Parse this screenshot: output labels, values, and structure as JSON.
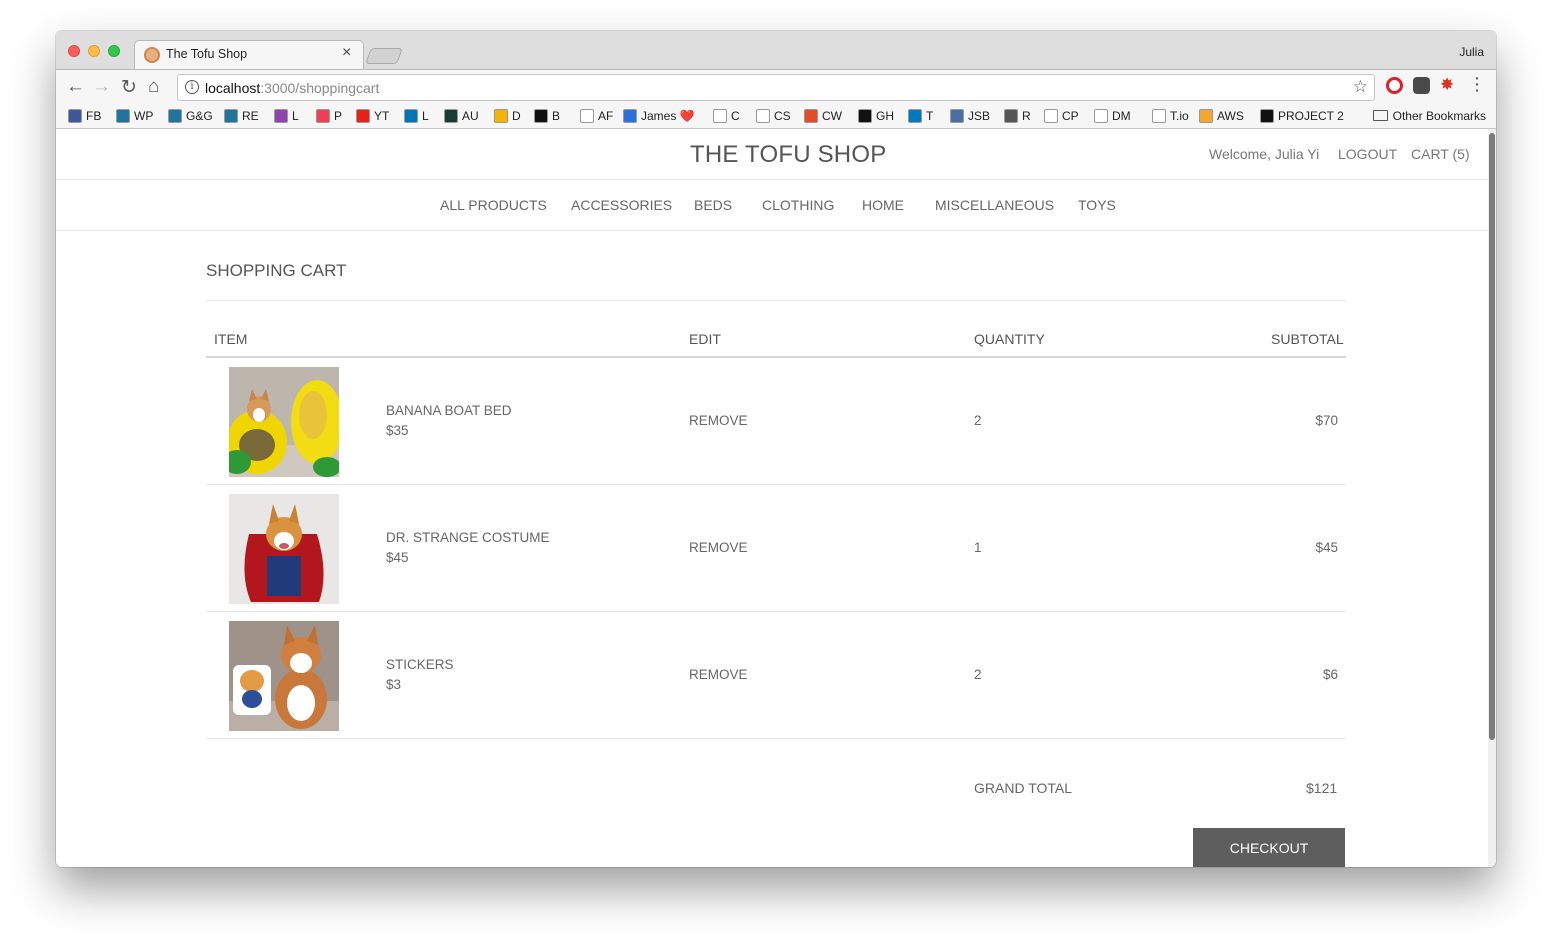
{
  "browser": {
    "tab_title": "The Tofu Shop",
    "tab_close": "×",
    "profile_name": "Julia",
    "url_host": "localhost",
    "url_path": ":3000/shoppingcart",
    "bookmarks": [
      {
        "label": "FB",
        "color": "#3b5998"
      },
      {
        "label": "WP",
        "color": "#21759b"
      },
      {
        "label": "G&G",
        "color": "#21759b"
      },
      {
        "label": "RE",
        "color": "#21759b"
      },
      {
        "label": "L",
        "color": "#8e44ad"
      },
      {
        "label": "P",
        "color": "#ef4056"
      },
      {
        "label": "YT",
        "color": "#e62117"
      },
      {
        "label": "L",
        "color": "#0077b5"
      },
      {
        "label": "AU",
        "color": "#1a3c34"
      },
      {
        "label": "D",
        "color": "#f4b400"
      },
      {
        "label": "B",
        "color": "#111111"
      },
      {
        "label": "AF",
        "color": "#ffffff"
      },
      {
        "label": "James ❤️",
        "color": "#2a6fdb"
      },
      {
        "label": "C",
        "color": "#ffffff"
      },
      {
        "label": "CS",
        "color": "#ffffff"
      },
      {
        "label": "CW",
        "color": "#e34c26"
      },
      {
        "label": "GH",
        "color": "#111111"
      },
      {
        "label": "T",
        "color": "#0079bf"
      },
      {
        "label": "JSB",
        "color": "#4a6fa5"
      },
      {
        "label": "R",
        "color": "#555555"
      },
      {
        "label": "CP",
        "color": "#ffffff"
      },
      {
        "label": "DM",
        "color": "#ffffff"
      },
      {
        "label": "T.io",
        "color": "#ffffff"
      },
      {
        "label": "AWS",
        "color": "#f0a830"
      },
      {
        "label": "PROJECT 2",
        "color": "#111111"
      }
    ],
    "other_bookmarks": "Other Bookmarks"
  },
  "site": {
    "brand": "THE TOFU SHOP",
    "welcome": "Welcome, Julia Yi",
    "logout": "LOGOUT",
    "cart": "CART (5)",
    "categories": [
      "ALL PRODUCTS",
      "ACCESSORIES",
      "BEDS",
      "CLOTHING",
      "HOME",
      "MISCELLANEOUS",
      "TOYS"
    ]
  },
  "cart": {
    "title": "SHOPPING CART",
    "headers": {
      "item": "ITEM",
      "edit": "EDIT",
      "quantity": "QUANTITY",
      "subtotal": "SUBTOTAL"
    },
    "items": [
      {
        "name": "BANANA BOAT BED",
        "price": "$35",
        "action": "REMOVE",
        "quantity": "2",
        "subtotal": "$70"
      },
      {
        "name": "DR. STRANGE COSTUME",
        "price": "$45",
        "action": "REMOVE",
        "quantity": "1",
        "subtotal": "$45"
      },
      {
        "name": "STICKERS",
        "price": "$3",
        "action": "REMOVE",
        "quantity": "2",
        "subtotal": "$6"
      }
    ],
    "grand_total_label": "GRAND TOTAL",
    "grand_total_value": "$121",
    "checkout_label": "CHECKOUT"
  }
}
